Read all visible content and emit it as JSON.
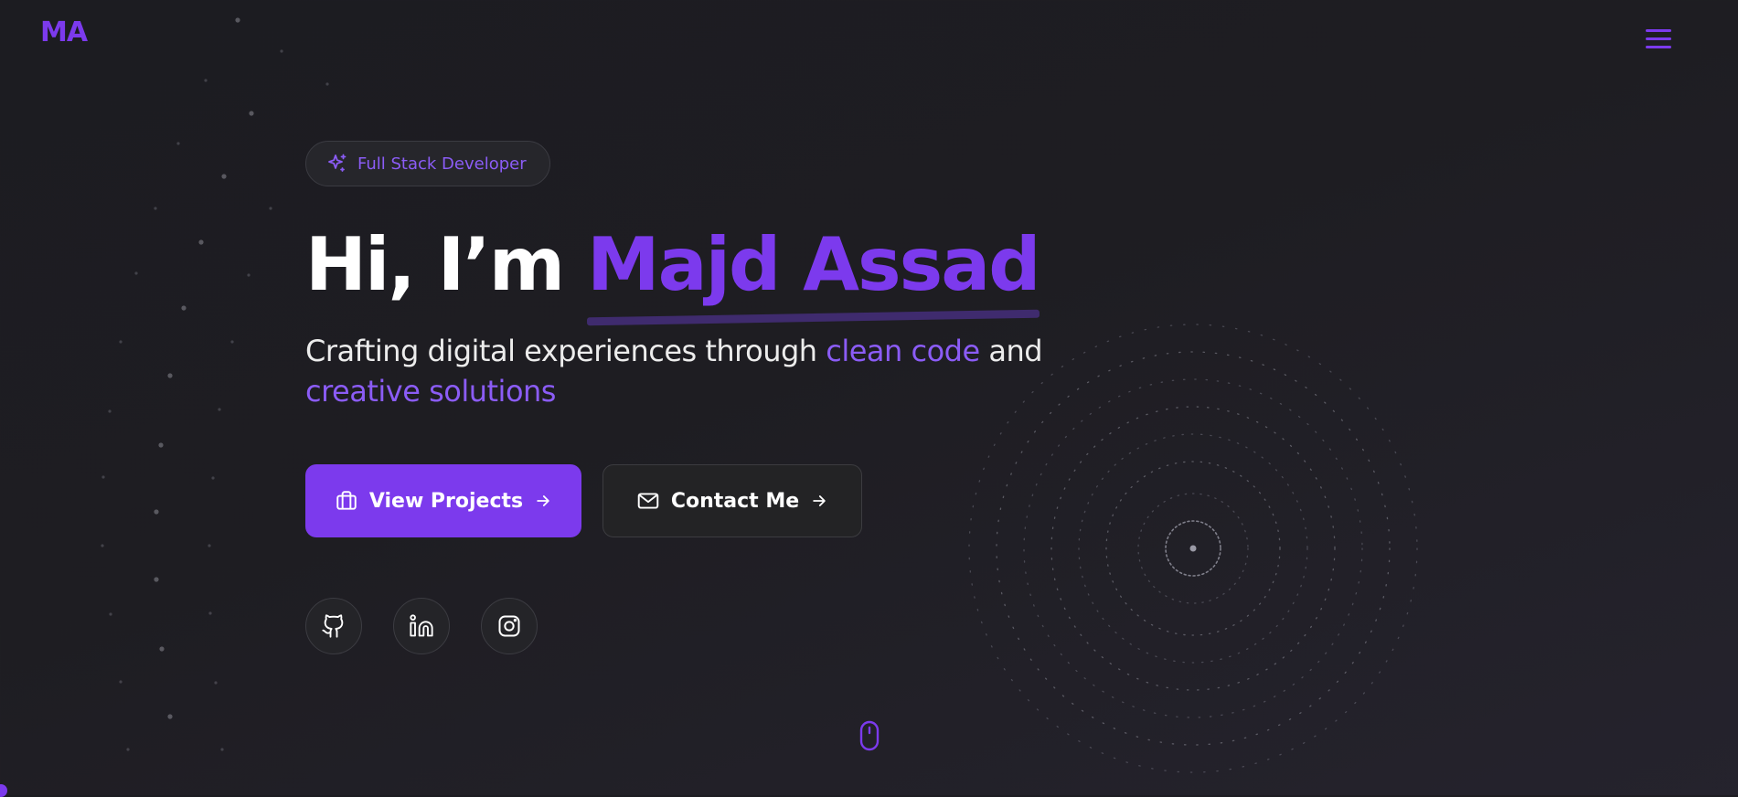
{
  "header": {
    "logo": "MA",
    "menu_icon": "hamburger-menu-icon"
  },
  "hero": {
    "badge": {
      "icon": "sparkles-icon",
      "label": "Full Stack Developer"
    },
    "title": {
      "prefix": "Hi, I’m ",
      "name": "Majd Assad"
    },
    "subtitle": {
      "part1": "Crafting digital experiences through ",
      "accent1": "clean code",
      "part2": " and",
      "accent2": "creative solutions"
    },
    "buttons": {
      "primary": {
        "icon": "briefcase-icon",
        "label": "View Projects",
        "arrow": "arrow-right-icon"
      },
      "secondary": {
        "icon": "mail-icon",
        "label": "Contact Me",
        "arrow": "arrow-right-icon"
      }
    },
    "social": [
      {
        "icon": "github-icon"
      },
      {
        "icon": "linkedin-icon"
      },
      {
        "icon": "instagram-icon"
      }
    ]
  },
  "scroll_indicator": {
    "icon": "mouse-scroll-icon"
  },
  "colors": {
    "accent": "#7c3aed",
    "accent_light": "#8b5cf6",
    "background": "#1e1e22",
    "text": "#ffffff"
  }
}
